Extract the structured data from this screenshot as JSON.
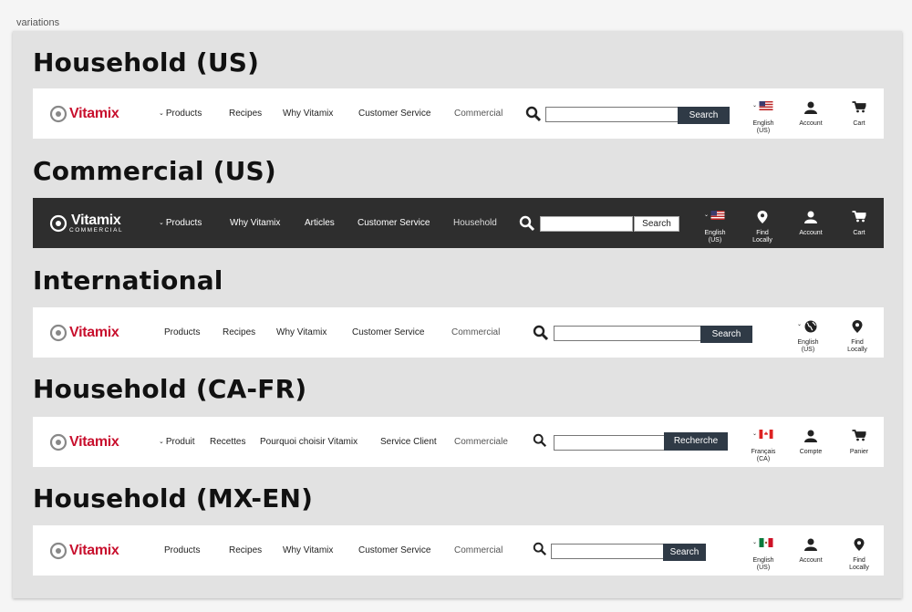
{
  "frame_label": "variations",
  "sections": [
    {
      "title": "Household (US)",
      "logo": "Vitamix",
      "nav": [
        "Products",
        "Recipes",
        "Why Vitamix",
        "Customer Service",
        "Commercial"
      ],
      "search_button": "Search",
      "utilities": [
        {
          "label": "English (US)",
          "icon": "us-flag-icon"
        },
        {
          "label": "Account",
          "icon": "account-icon"
        },
        {
          "label": "Cart",
          "icon": "cart-icon"
        }
      ]
    },
    {
      "title": "Commercial (US)",
      "logo": "Vitamix",
      "logo_sub": "COMMERCIAL",
      "nav": [
        "Products",
        "Why Vitamix",
        "Articles",
        "Customer Service",
        "Household"
      ],
      "search_button": "Search",
      "utilities": [
        {
          "label": "English (US)",
          "icon": "us-flag-icon"
        },
        {
          "label": "Find Locally",
          "icon": "location-pin-icon"
        },
        {
          "label": "Account",
          "icon": "account-icon"
        },
        {
          "label": "Cart",
          "icon": "cart-icon"
        }
      ]
    },
    {
      "title": "International",
      "logo": "Vitamix",
      "nav": [
        "Products",
        "Recipes",
        "Why Vitamix",
        "Customer Service",
        "Commercial"
      ],
      "search_button": "Search",
      "utilities": [
        {
          "label": "English (US)",
          "icon": "globe-icon"
        },
        {
          "label": "Find Locally",
          "icon": "location-pin-icon"
        }
      ]
    },
    {
      "title": "Household (CA-FR)",
      "logo": "Vitamix",
      "nav": [
        "Produit",
        "Recettes",
        "Pourquoi choisir Vitamix",
        "Service Client",
        "Commerciale"
      ],
      "search_button": "Recherche",
      "utilities": [
        {
          "label": "Français (CA)",
          "icon": "canada-flag-icon"
        },
        {
          "label": "Compte",
          "icon": "account-icon"
        },
        {
          "label": "Panier",
          "icon": "cart-icon"
        }
      ]
    },
    {
      "title": "Household (MX-EN)",
      "logo": "Vitamix",
      "nav": [
        "Products",
        "Recipes",
        "Why Vitamix",
        "Customer Service",
        "Commercial"
      ],
      "search_button": "Search",
      "utilities": [
        {
          "label": "English (US)",
          "icon": "mexico-flag-icon"
        },
        {
          "label": "Account",
          "icon": "account-icon"
        },
        {
          "label": "Find Locally",
          "icon": "location-pin-icon"
        }
      ]
    }
  ],
  "colors": {
    "brand_red": "#c8102e",
    "search_button": "#2f3a46",
    "dark_bar": "#2e2e2e",
    "board": "#e2e2e2"
  }
}
